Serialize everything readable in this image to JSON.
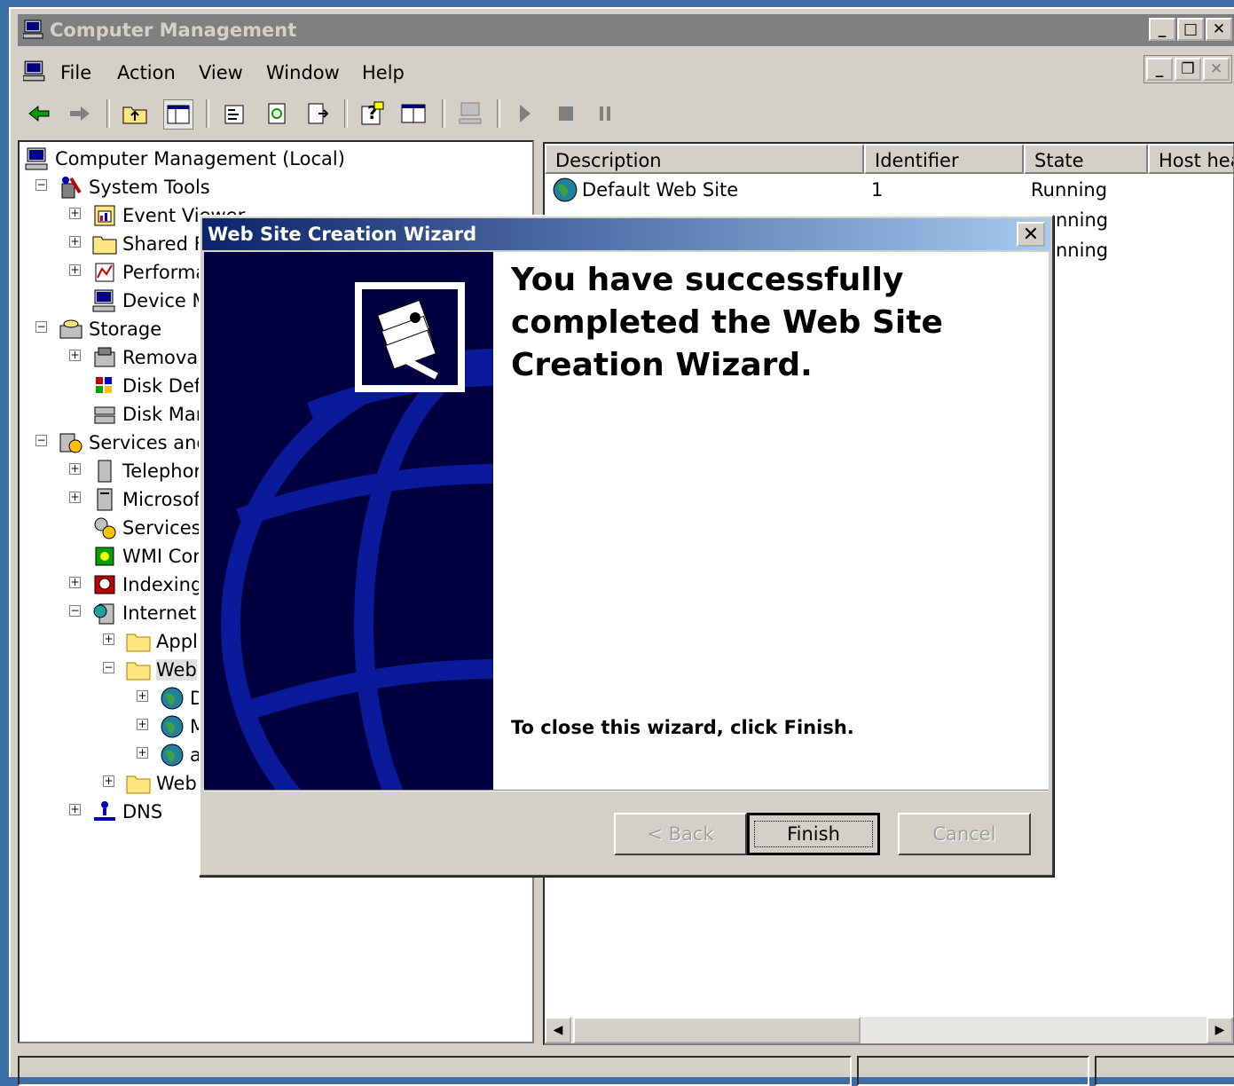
{
  "window": {
    "title": "Computer Management"
  },
  "menu": [
    {
      "label": "File"
    },
    {
      "label": "Action"
    },
    {
      "label": "View"
    },
    {
      "label": "Window"
    },
    {
      "label": "Help"
    }
  ],
  "tree": [
    {
      "label": "Computer Management (Local)"
    },
    {
      "label": "System Tools"
    },
    {
      "label": "Event Viewer"
    },
    {
      "label": "Shared F"
    },
    {
      "label": "Performa"
    },
    {
      "label": "Device M"
    },
    {
      "label": "Storage"
    },
    {
      "label": "Removal"
    },
    {
      "label": "Disk Defr"
    },
    {
      "label": "Disk Man"
    },
    {
      "label": "Services and"
    },
    {
      "label": "Telephor"
    },
    {
      "label": "Microsof"
    },
    {
      "label": "Services"
    },
    {
      "label": "WMI Cor"
    },
    {
      "label": "Indexing"
    },
    {
      "label": "Internet"
    },
    {
      "label": "Appl"
    },
    {
      "label": "Web"
    },
    {
      "label": "D"
    },
    {
      "label": "M"
    },
    {
      "label": "a"
    },
    {
      "label": "Web"
    },
    {
      "label": "DNS"
    }
  ],
  "list": {
    "columns": [
      "Description",
      "Identifier",
      "State",
      "Host hea"
    ],
    "rows": [
      {
        "description": "Default Web Site",
        "identifier": "1",
        "state": "Running"
      },
      {
        "description": "",
        "identifier": "",
        "state": "nning"
      },
      {
        "description": "",
        "identifier": "",
        "state": "nning"
      }
    ]
  },
  "dialog": {
    "title": "Web Site Creation Wizard",
    "heading": "You have successfully completed the Web Site Creation Wizard.",
    "instruction": "To close this wizard, click Finish.",
    "back_label": "< Back",
    "finish_label": "Finish",
    "cancel_label": "Cancel"
  }
}
